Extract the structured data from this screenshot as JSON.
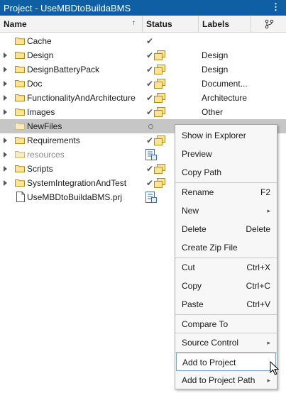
{
  "window": {
    "title": "Project - UseMBDtoBuildaBMS",
    "menu_glyph": "⋮"
  },
  "columns": {
    "name": "Name",
    "status": "Status",
    "labels": "Labels",
    "sort_glyph": "↑"
  },
  "rows": [
    {
      "name": "Cache",
      "expandable": false,
      "icon": "folder-icon",
      "status": "check",
      "label": ""
    },
    {
      "name": "Design",
      "expandable": true,
      "icon": "folder-icon",
      "status": "check+project",
      "label": "Design"
    },
    {
      "name": "DesignBatteryPack",
      "expandable": true,
      "icon": "folder-icon",
      "status": "check+project",
      "label": "Design"
    },
    {
      "name": "Doc",
      "expandable": true,
      "icon": "folder-icon",
      "status": "check+project",
      "label": "Document..."
    },
    {
      "name": "FunctionalityAndArchitecture",
      "expandable": true,
      "icon": "folder-icon",
      "status": "check+project",
      "label": "Architecture"
    },
    {
      "name": "Images",
      "expandable": true,
      "icon": "folder-icon",
      "status": "check+project",
      "label": "Other"
    },
    {
      "name": "NewFiles",
      "expandable": false,
      "icon": "folder-icon",
      "status": "circle",
      "label": "",
      "selected": true
    },
    {
      "name": "Requirements",
      "expandable": true,
      "icon": "folder-icon",
      "status": "check+project",
      "label": ""
    },
    {
      "name": "resources",
      "expandable": true,
      "icon": "folder-icon",
      "status": "project-file",
      "label": "",
      "dim": true
    },
    {
      "name": "Scripts",
      "expandable": true,
      "icon": "folder-icon",
      "status": "check+project",
      "label": ""
    },
    {
      "name": "SystemIntegrationAndTest",
      "expandable": true,
      "icon": "folder-icon",
      "status": "check+project",
      "label": ""
    },
    {
      "name": "UseMBDtoBuildaBMS.prj",
      "expandable": false,
      "icon": "file-icon",
      "status": "project-file",
      "label": ""
    }
  ],
  "context_menu": {
    "show_in_explorer": "Show in Explorer",
    "preview": "Preview",
    "copy_path": "Copy Path",
    "rename": "Rename",
    "rename_shortcut": "F2",
    "new": "New",
    "delete": "Delete",
    "delete_shortcut": "Delete",
    "create_zip": "Create Zip File",
    "cut": "Cut",
    "cut_shortcut": "Ctrl+X",
    "copy": "Copy",
    "copy_shortcut": "Ctrl+C",
    "paste": "Paste",
    "paste_shortcut": "Ctrl+V",
    "compare_to": "Compare To",
    "source_control": "Source Control",
    "add_to_project": "Add to Project",
    "add_to_project_path": "Add to Project Path",
    "submenu_glyph": "▸"
  },
  "colors": {
    "title_bar": "#0e5fa3",
    "folder_yellow": "#f1c232",
    "selected_row": "#c6c6c6",
    "hover_border": "#7a9fc9"
  }
}
